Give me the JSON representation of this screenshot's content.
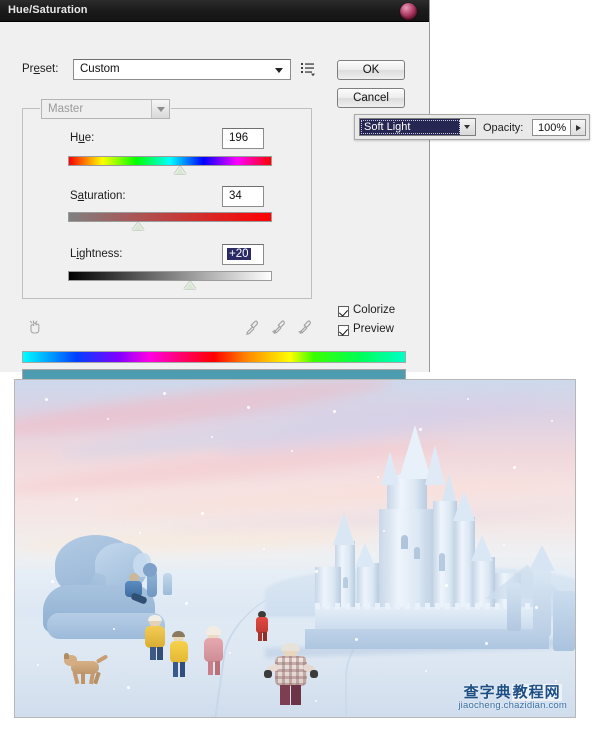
{
  "dialog": {
    "title": "Hue/Saturation",
    "close_icon": "close-orb-icon",
    "preset": {
      "label": "Preset:",
      "value": "Custom",
      "menu_icon": "preset-options-icon",
      "arrow_icon": "chevron-down-icon"
    },
    "buttons": {
      "ok": "OK",
      "cancel": "Cancel"
    },
    "channel": {
      "value": "Master",
      "arrow_icon": "chevron-down-icon"
    },
    "sliders": [
      {
        "label": "Hue:",
        "value": "196",
        "thumb_pct": 54,
        "track": "hue",
        "selected": false
      },
      {
        "label": "Saturation:",
        "value": "34",
        "thumb_pct": 34,
        "track": "sat",
        "selected": false
      },
      {
        "label": "Lightness:",
        "value": "+20",
        "thumb_pct": 57,
        "track": "light",
        "selected": true
      }
    ],
    "tools": {
      "hand_icon": "targeted-adjustment-hand-icon",
      "eyedropper_icon": "eyedropper-icon",
      "eyedropper_plus_icon": "eyedropper-plus-icon",
      "eyedropper_minus_icon": "eyedropper-minus-icon"
    },
    "checkboxes": [
      {
        "label": "Colorize",
        "checked": true
      },
      {
        "label": "Preview",
        "checked": true
      }
    ],
    "bars": {
      "spectrum_name": "hue-spectrum-bar",
      "result_color": "#4e9cb0"
    }
  },
  "blend_panel": {
    "mode": "Soft Light",
    "mode_arrow_icon": "chevron-down-icon",
    "opacity_label": "Opacity:",
    "opacity_value": "100%",
    "stepper_icon": "stepper-arrow-icon"
  },
  "photo": {
    "name": "winter-ice-castle-preview",
    "watermark_cn": "查字典",
    "watermark_cn2": "教程网",
    "watermark_url": "jiaocheng.chazidian.com"
  }
}
